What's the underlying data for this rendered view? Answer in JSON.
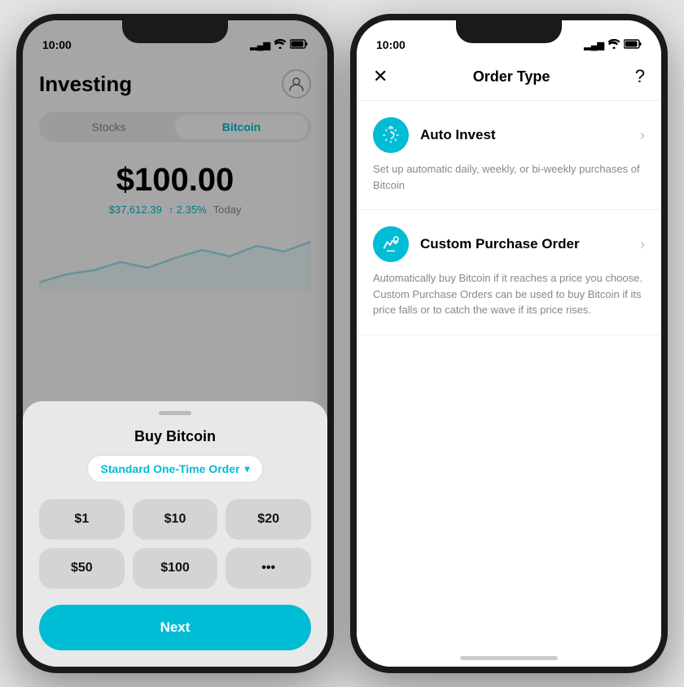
{
  "left_phone": {
    "status": {
      "time": "10:00",
      "signal": "▂▄▆",
      "wifi": "⌇",
      "battery": "█"
    },
    "header": {
      "title": "Investing",
      "avatar_label": "user avatar"
    },
    "tabs": [
      {
        "label": "Stocks",
        "active": false
      },
      {
        "label": "Bitcoin",
        "active": true
      }
    ],
    "price": "$100.00",
    "btc_price": "$37,612.39",
    "change": "↑ 2.35%",
    "period": "Today",
    "sheet": {
      "handle_label": "drag handle",
      "title": "Buy Bitcoin",
      "order_type": "Standard One-Time Order",
      "order_chevron": "▾",
      "amounts": [
        "$1",
        "$10",
        "$20",
        "$50",
        "$100",
        "•••"
      ],
      "next_label": "Next"
    }
  },
  "right_phone": {
    "status": {
      "time": "10:00",
      "signal": "▂▄▆",
      "wifi": "⌇",
      "battery": "█"
    },
    "header": {
      "close": "✕",
      "title": "Order Type",
      "help": "?"
    },
    "options": [
      {
        "icon": "↺",
        "name": "Auto Invest",
        "description": "Set up automatic daily, weekly, or bi-weekly purchases of Bitcoin"
      },
      {
        "icon": "⤻",
        "name": "Custom Purchase Order",
        "description": "Automatically buy Bitcoin if it reaches a price you choose. Custom Purchase Orders can be used to buy Bitcoin if its price falls or to catch the wave if its price rises."
      }
    ]
  }
}
